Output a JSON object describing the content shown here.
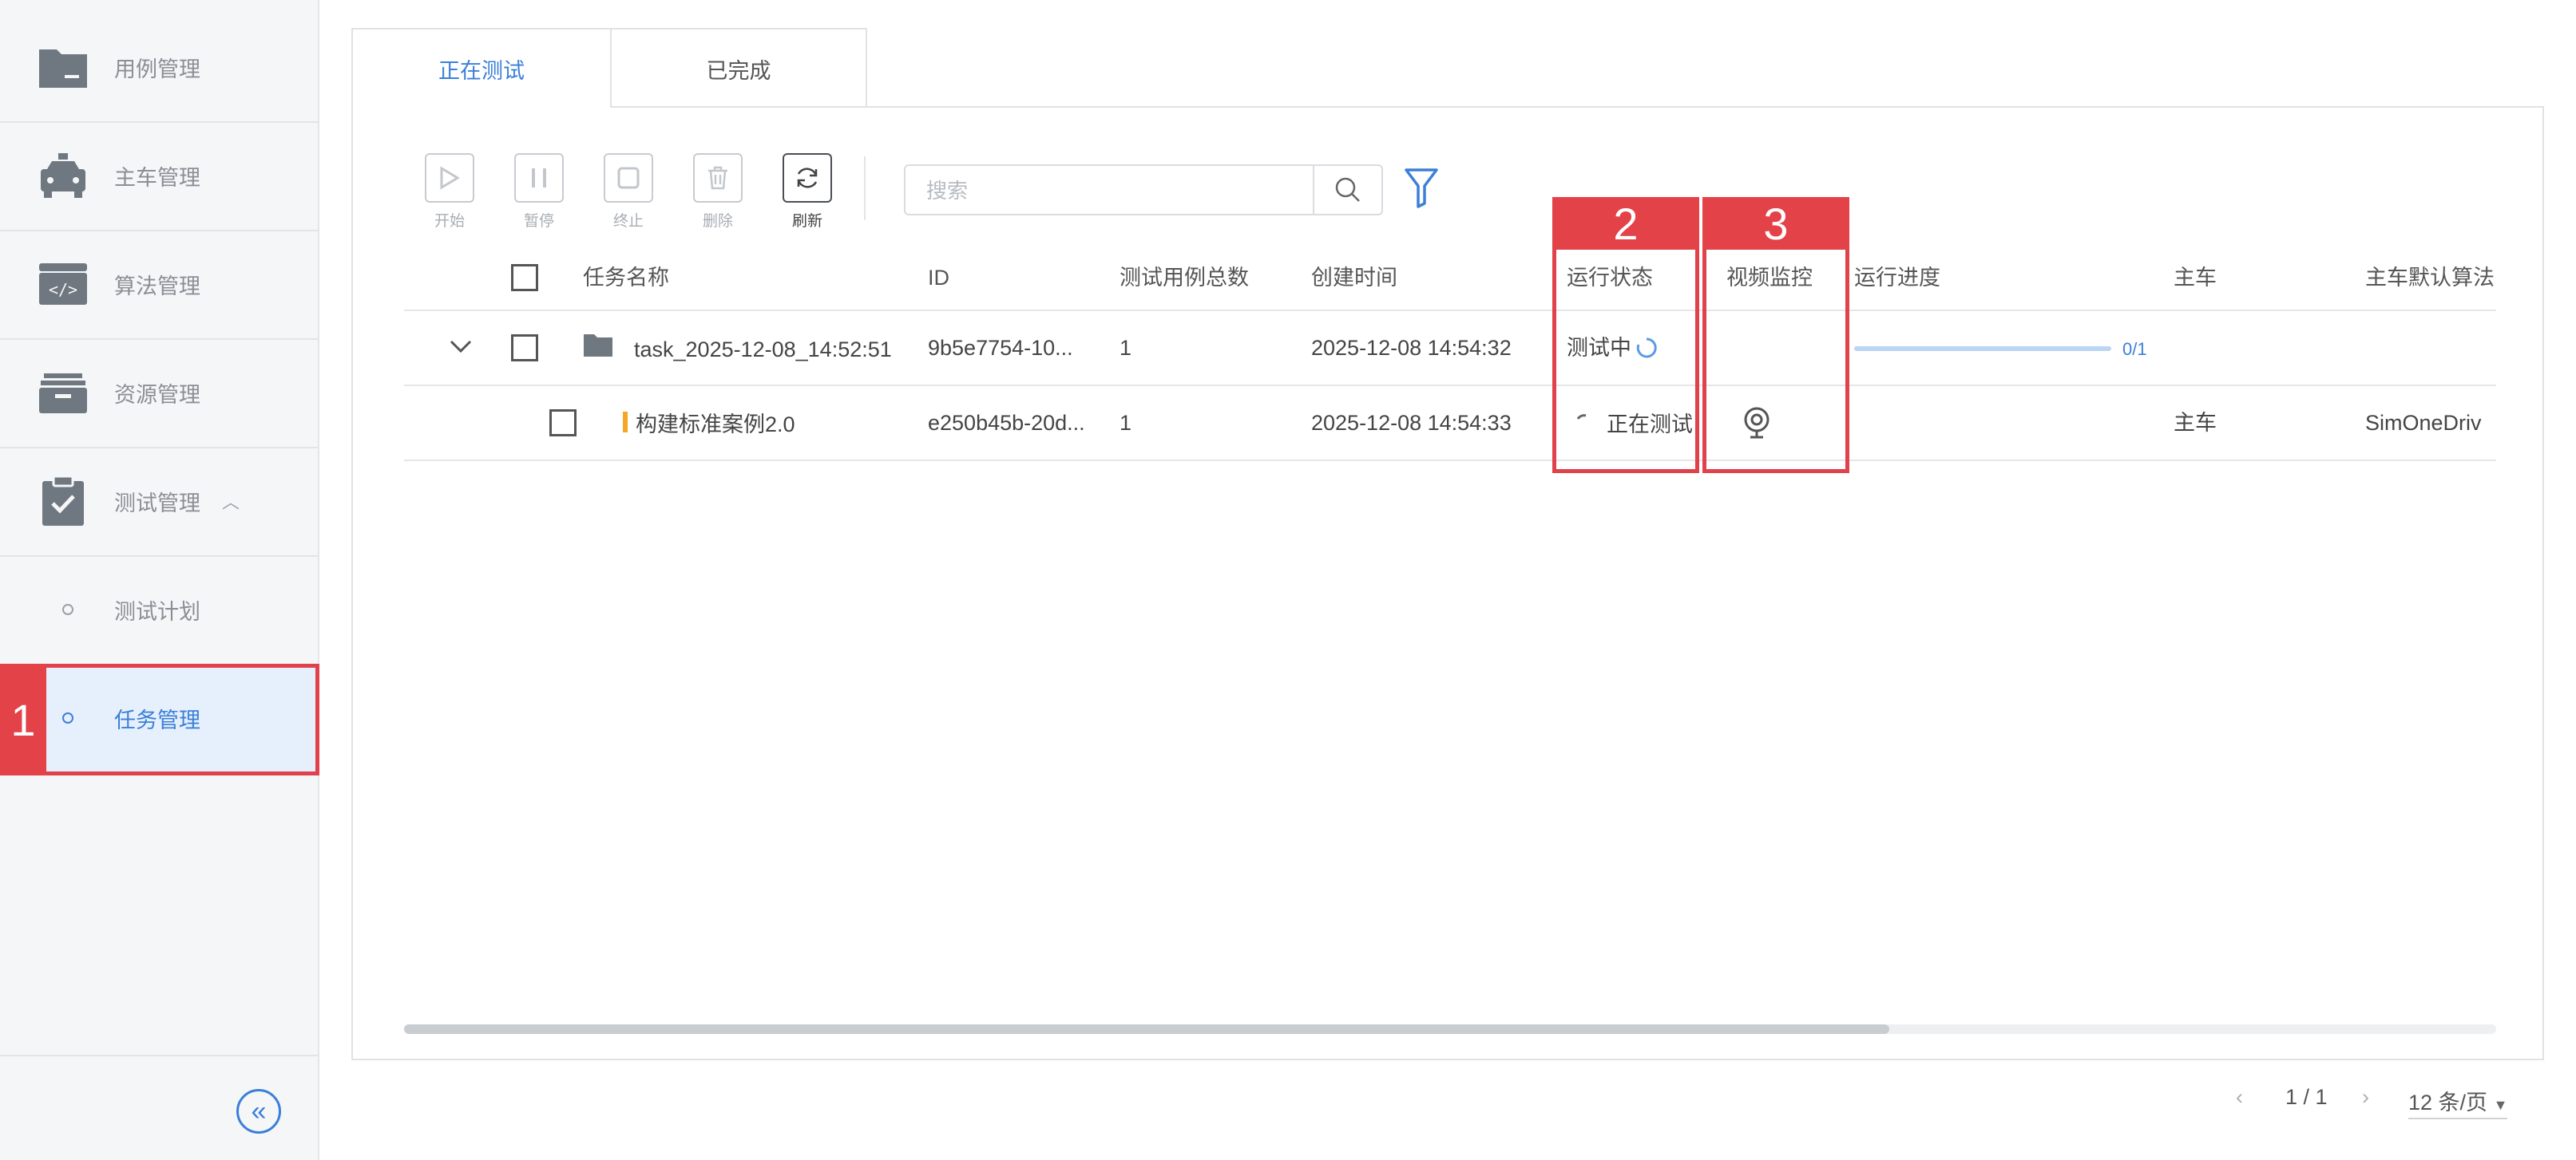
{
  "sidebar": {
    "items": [
      {
        "label": "用例管理",
        "icon": "folder-icon"
      },
      {
        "label": "主车管理",
        "icon": "car-icon"
      },
      {
        "label": "算法管理",
        "icon": "code-icon"
      },
      {
        "label": "资源管理",
        "icon": "archive-icon"
      },
      {
        "label": "测试管理",
        "icon": "clipboard-check-icon",
        "expanded": true
      }
    ],
    "sub_items": [
      {
        "label": "测试计划",
        "active": false
      },
      {
        "label": "任务管理",
        "active": true
      }
    ],
    "collapse_icon": "double-chevron-left-icon"
  },
  "annotations": {
    "label1": "1",
    "label2": "2",
    "label3": "3",
    "color": "#e0414a"
  },
  "tabs": [
    {
      "label": "正在测试",
      "active": true
    },
    {
      "label": "已完成",
      "active": false
    }
  ],
  "toolbar": {
    "start": "开始",
    "pause": "暂停",
    "stop": "终止",
    "delete": "删除",
    "refresh": "刷新"
  },
  "search": {
    "placeholder": "搜索"
  },
  "table": {
    "headers": {
      "name": "任务名称",
      "id": "ID",
      "count": "测试用例总数",
      "created": "创建时间",
      "status": "运行状态",
      "video": "视频监控",
      "progress": "运行进度",
      "vehicle": "主车",
      "algorithm": "主车默认算法"
    },
    "task_row": {
      "name": "task_2025-12-08_14:52:51",
      "id": "9b5e7754-10...",
      "count": "1",
      "created": "2025-12-08 14:54:32",
      "status": "测试中",
      "progress_text": "0/1",
      "progress_fraction": 0
    },
    "case_row": {
      "name": "构建标准案例2.0",
      "id": "e250b45b-20d...",
      "count": "1",
      "created": "2025-12-08 14:54:33",
      "status": "正在测试",
      "vehicle": "主车",
      "algorithm": "SimOneDriv"
    }
  },
  "pagination": {
    "page": "1 / 1",
    "per_page": "12 条/页"
  },
  "colors": {
    "accent": "#3b7fd9",
    "highlight": "#e0414a"
  }
}
